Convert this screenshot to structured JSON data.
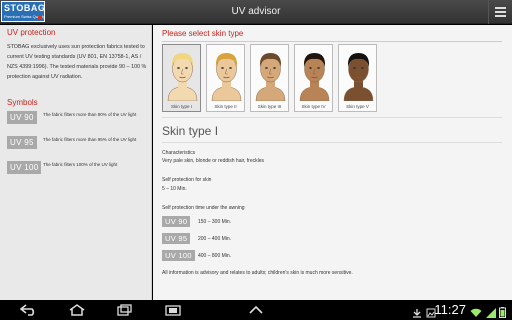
{
  "app": {
    "logo_main": "STOBAG",
    "logo_sub": "Premium Swiss Quality",
    "title": "UV advisor"
  },
  "left": {
    "protection_title": "UV protection",
    "protection_text": "STOBAG exclusively uses sun protection fabrics tested to current UV testing standards (UV 801, EN 13758-1, AS / NZS 4399:1996). The tested materials provide 90 – 100 % protection against UV radiation.",
    "symbols_title": "Symbols",
    "symbols": [
      {
        "badge": "UV 90",
        "desc": "The fabric filters more than 90% of the UV light"
      },
      {
        "badge": "UV 95",
        "desc": "The fabric filters more than 95% of the UV light"
      },
      {
        "badge": "UV 100",
        "desc": "The fabric filters 100% of the UV light"
      }
    ]
  },
  "right": {
    "select_title": "Please select skin type",
    "skin_types": [
      {
        "label": "Skin type I",
        "skin": "#f2d9b0",
        "hair": "#f0d680"
      },
      {
        "label": "Skin type II",
        "skin": "#eac89a",
        "hair": "#d9a23a"
      },
      {
        "label": "Skin type III",
        "skin": "#d4a878",
        "hair": "#6a4a2a"
      },
      {
        "label": "Skin type IV",
        "skin": "#b88356",
        "hair": "#1e140c"
      },
      {
        "label": "Skin type V",
        "skin": "#7a5030",
        "hair": "#151010"
      }
    ],
    "selected_index": 0,
    "detail": {
      "title": "Skin type I",
      "characteristics_label": "Characteristics",
      "characteristics_value": "Very pale skin, blonde or reddish hair, freckles",
      "self_protection_label": "Self protection for skin",
      "self_protection_value": "5 – 10 Min.",
      "awning_label": "Self protection time under the awning",
      "awning_rows": [
        {
          "badge": "UV 90",
          "value": "150 – 300 Min."
        },
        {
          "badge": "UV 95",
          "value": "200 – 400 Min."
        },
        {
          "badge": "UV 100",
          "value": "400 – 800 Min."
        }
      ],
      "footnote": "All information is advisory and relates to adults; children's skin is much more sensitive."
    }
  },
  "statusbar": {
    "time": "11:27"
  },
  "colors": {
    "accent_red": "#c8231e",
    "badge_gray": "#a9a9a9",
    "brand_blue": "#2a6fb3"
  }
}
